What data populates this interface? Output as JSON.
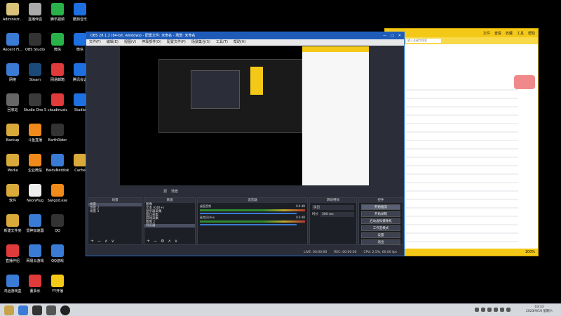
{
  "desktop": {
    "icons": [
      {
        "label": "Administr...",
        "color": "#d9c27a",
        "col": 0,
        "row": 0
      },
      {
        "label": "Recent Fi...",
        "color": "#3a7bd5",
        "col": 0,
        "row": 1
      },
      {
        "label": "网络",
        "color": "#3a7bd5",
        "col": 0,
        "row": 2
      },
      {
        "label": "回收站",
        "color": "#666",
        "col": 0,
        "row": 3
      },
      {
        "label": "Backup",
        "color": "#d9a93a",
        "col": 0,
        "row": 4
      },
      {
        "label": "Media",
        "color": "#d9a93a",
        "col": 0,
        "row": 5
      },
      {
        "label": "软件",
        "color": "#d9a93a",
        "col": 0,
        "row": 6
      },
      {
        "label": "新建文件夹",
        "color": "#d9a93a",
        "col": 0,
        "row": 7
      },
      {
        "label": "直播伴侣",
        "color": "#e03a3a",
        "col": 0,
        "row": 8
      },
      {
        "label": "鸿运游戏盒",
        "color": "#3a7bd5",
        "col": 0,
        "row": 9
      },
      {
        "label": "直播伴侣",
        "color": "#aaa",
        "col": 1,
        "row": 0
      },
      {
        "label": "OBS Studio",
        "color": "#333",
        "col": 1,
        "row": 1
      },
      {
        "label": "Steam",
        "color": "#1b4a7a",
        "col": 1,
        "row": 2
      },
      {
        "label": "Studio One 5",
        "color": "#3a3a3a",
        "col": 1,
        "row": 3
      },
      {
        "label": "斗鱼直播",
        "color": "#f08a1a",
        "col": 1,
        "row": 4
      },
      {
        "label": "企业微信",
        "color": "#f08a1a",
        "col": 1,
        "row": 5
      },
      {
        "label": "NeonPlug",
        "color": "#eee",
        "col": 1,
        "row": 6
      },
      {
        "label": "雷神加速器",
        "color": "#3a7bd5",
        "col": 1,
        "row": 7
      },
      {
        "label": "网易云游戏",
        "color": "#3a7bd5",
        "col": 1,
        "row": 8
      },
      {
        "label": "董事长",
        "color": "#e03a3a",
        "col": 1,
        "row": 9
      },
      {
        "label": "腾讯视频",
        "color": "#2ab24a",
        "col": 2,
        "row": 0
      },
      {
        "label": "微信",
        "color": "#2ab24a",
        "col": 2,
        "row": 1
      },
      {
        "label": "网易邮箱",
        "color": "#e03a3a",
        "col": 2,
        "row": 2
      },
      {
        "label": "cloudmusic",
        "color": "#e03a3a",
        "col": 2,
        "row": 3
      },
      {
        "label": "EarthRider",
        "color": "#333",
        "col": 2,
        "row": 4
      },
      {
        "label": "BaiduNetdisk",
        "color": "#3a7bd5",
        "col": 2,
        "row": 5
      },
      {
        "label": "Swigod.exe",
        "color": "#f08a1a",
        "col": 2,
        "row": 6
      },
      {
        "label": "QQ",
        "color": "#333",
        "col": 2,
        "row": 7
      },
      {
        "label": "QQ游戏",
        "color": "#3a7bd5",
        "col": 2,
        "row": 8
      },
      {
        "label": "YY开播",
        "color": "#f4c816",
        "col": 2,
        "row": 9
      },
      {
        "label": "酷狗音乐",
        "color": "#1e6fe0",
        "col": 3,
        "row": 0
      },
      {
        "label": "微信",
        "color": "#1e6fe0",
        "col": 3,
        "row": 1
      },
      {
        "label": "腾讯会议",
        "color": "#1e6fe0",
        "col": 3,
        "row": 2
      },
      {
        "label": "Studio",
        "color": "#1e6fe0",
        "col": 3,
        "row": 3
      },
      {
        "label": "Cache",
        "color": "#d9a93a",
        "col": 3,
        "row": 5
      }
    ]
  },
  "obs": {
    "title": "OBS 28.1.2 (64-bit, windows) - 配置文件: 未命名 - 场景: 未命名",
    "menu": [
      "文件(F)",
      "编辑(E)",
      "视图(V)",
      "停靠部件(D)",
      "配置文件(P)",
      "场景集合(S)",
      "工具(T)",
      "帮助(H)"
    ],
    "preview_tabs": [
      "源",
      "场景"
    ],
    "scenes": {
      "title": "场景",
      "items": [
        "场景",
        "场景 2",
        "场景 3"
      ]
    },
    "sources": {
      "title": "来源",
      "items": [
        "图像",
        "文本 (GDI+)",
        "显示器采集",
        "窗口采集",
        "游戏采集",
        "图像 2",
        "浏览器"
      ]
    },
    "mixer": {
      "title": "混音器",
      "channels": [
        {
          "name": "桌面音频",
          "db": "0.0 dB"
        },
        {
          "name": "麦克风/Aux",
          "db": "0.0 dB"
        }
      ]
    },
    "transitions": {
      "title": "转场特效",
      "type": "淡出",
      "duration_label": "时长",
      "duration": "300 ms"
    },
    "controls": {
      "title": "控件",
      "buttons": [
        "开始推流",
        "开始录制",
        "启动虚拟摄像机",
        "工作室模式",
        "设置",
        "退出"
      ]
    },
    "status": {
      "live": "LIVE: 00:00:00",
      "rec": "REC: 00:00:00",
      "cpu": "CPU: 2.5%, 60.00 fps"
    }
  },
  "browser": {
    "menu": [
      "文件",
      "查看",
      "收藏",
      "工具",
      "帮助"
    ],
    "search_placeholder": "输入关键字搜索",
    "zoom": "100%"
  },
  "taskbar": {
    "clock_time": "03:33",
    "clock_date": "2023/9/16 星期六"
  }
}
